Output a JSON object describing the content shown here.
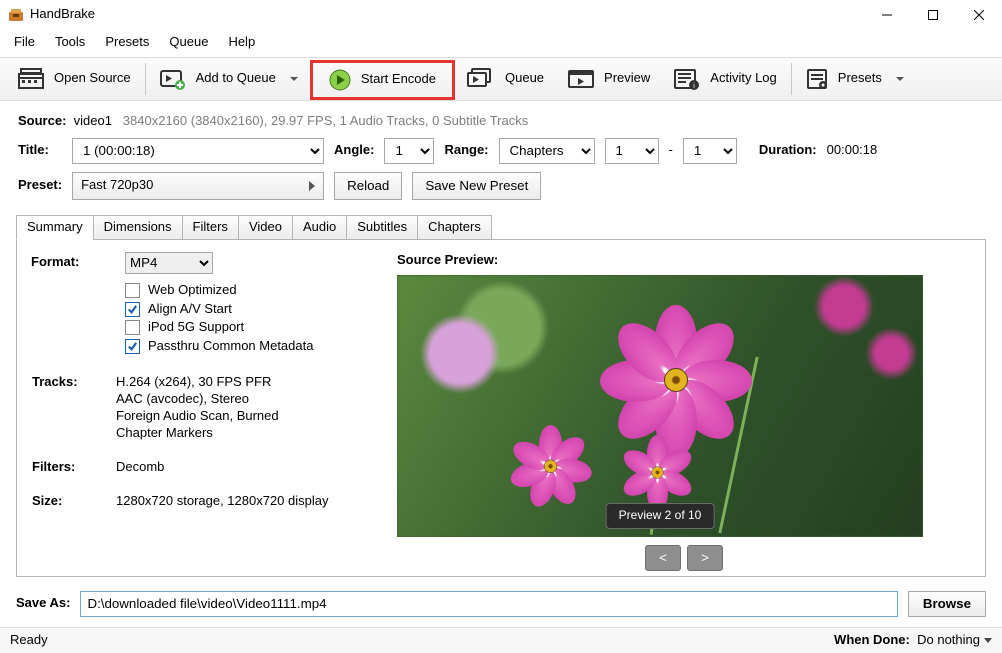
{
  "app": {
    "title": "HandBrake"
  },
  "menus": [
    "File",
    "Tools",
    "Presets",
    "Queue",
    "Help"
  ],
  "toolbar": {
    "open": "Open Source",
    "add_queue": "Add to Queue",
    "start_encode": "Start Encode",
    "queue": "Queue",
    "preview": "Preview",
    "activity": "Activity Log",
    "presets": "Presets"
  },
  "source": {
    "label": "Source:",
    "name": "video1",
    "info": "3840x2160 (3840x2160), 29.97 FPS, 1 Audio Tracks, 0 Subtitle Tracks"
  },
  "title_row": {
    "title_label": "Title:",
    "title_value": "1  (00:00:18)",
    "angle_label": "Angle:",
    "angle_value": "1",
    "range_label": "Range:",
    "range_mode": "Chapters",
    "range_from": "1",
    "range_dash": "-",
    "range_to": "1",
    "duration_label": "Duration:",
    "duration_value": "00:00:18"
  },
  "preset_row": {
    "label": "Preset:",
    "value": "Fast 720p30",
    "reload": "Reload",
    "save_new": "Save New Preset"
  },
  "tabs": [
    "Summary",
    "Dimensions",
    "Filters",
    "Video",
    "Audio",
    "Subtitles",
    "Chapters"
  ],
  "summary": {
    "format_label": "Format:",
    "format_value": "MP4",
    "opts": {
      "web": "Web Optimized",
      "align": "Align A/V Start",
      "ipod": "iPod 5G Support",
      "passthru": "Passthru Common Metadata"
    },
    "tracks_label": "Tracks:",
    "tracks_lines": [
      "H.264 (x264), 30 FPS PFR",
      "AAC (avcodec), Stereo",
      "Foreign Audio Scan, Burned",
      "Chapter Markers"
    ],
    "filters_label": "Filters:",
    "filters_value": "Decomb",
    "size_label": "Size:",
    "size_value": "1280x720 storage, 1280x720 display"
  },
  "preview": {
    "label": "Source Preview:",
    "badge": "Preview 2 of 10",
    "prev": "<",
    "next": ">"
  },
  "saveas": {
    "label": "Save As:",
    "value": "D:\\downloaded file\\video\\Video1111.mp4",
    "browse": "Browse"
  },
  "status": {
    "ready": "Ready",
    "when_done_label": "When Done:",
    "when_done_value": "Do nothing"
  }
}
